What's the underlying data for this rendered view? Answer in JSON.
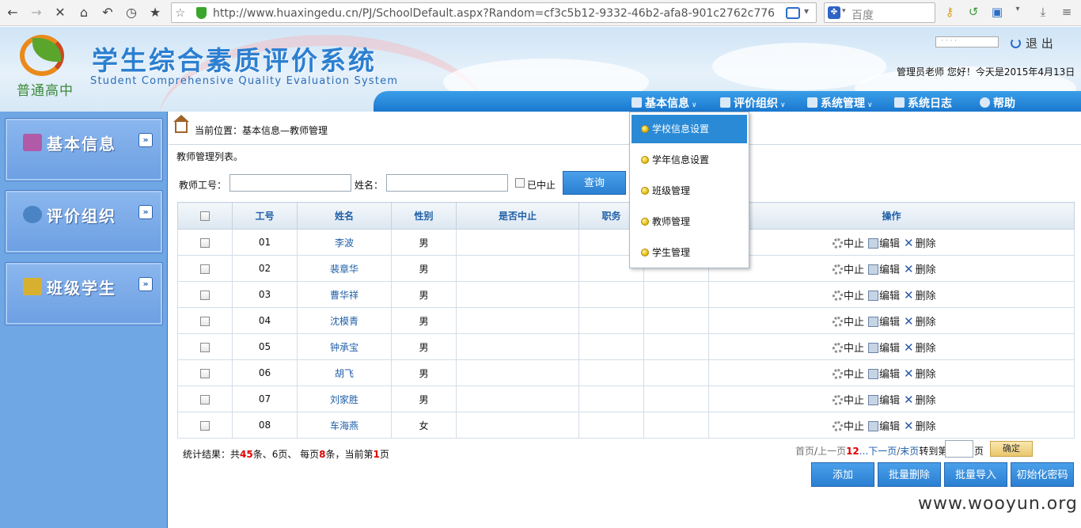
{
  "browser": {
    "url": "http://www.huaxingedu.cn/PJ/SchoolDefault.aspx?Random=cf3c5b12-9332-46b2-afa8-901c2762c776",
    "search_placeholder": "百度"
  },
  "header": {
    "logo_text": "普通高中",
    "title": "学生综合素质评价系统",
    "subtitle": "Student Comprehensive Quality Evaluation System",
    "password_placeholder": "· · · ·",
    "logout_label": "退 出",
    "greeting": "管理员老师 您好！今天是2015年4月13日"
  },
  "nav": {
    "items": [
      {
        "label": "基本信息",
        "icon": "info-icon",
        "has_caret": true
      },
      {
        "label": "评价组织",
        "icon": "person-icon",
        "has_caret": true
      },
      {
        "label": "系统管理",
        "icon": "gear-icon",
        "has_caret": true
      },
      {
        "label": "系统日志",
        "icon": "log-icon",
        "has_caret": false
      },
      {
        "label": "帮助",
        "icon": "help-icon",
        "has_caret": false
      }
    ],
    "dropdown": [
      {
        "label": "学校信息设置",
        "active": true
      },
      {
        "label": "学年信息设置",
        "active": false
      },
      {
        "label": "班级管理",
        "active": false
      },
      {
        "label": "教师管理",
        "active": false
      },
      {
        "label": "学生管理",
        "active": false
      }
    ]
  },
  "sidebar": {
    "items": [
      {
        "label": "基本信息",
        "icon": "briefcase-icon",
        "color": "#b05aa8"
      },
      {
        "label": "评价组织",
        "icon": "globe-icon",
        "color": "#4a84c4"
      },
      {
        "label": "班级学生",
        "icon": "users-icon",
        "color": "#d8b030"
      }
    ]
  },
  "main": {
    "breadcrumb": "当前位置：基本信息—教师管理",
    "list_desc": "教师管理列表。",
    "filter": {
      "teacher_id_label": "教师工号：",
      "name_label": "姓名：",
      "suspended_label": "已中止",
      "query_label": "查询"
    },
    "table": {
      "headers": [
        "",
        "工号",
        "姓名",
        "性别",
        "是否中止",
        "职务",
        "",
        "操作"
      ],
      "rows": [
        {
          "id": "01",
          "name": "李波",
          "gender": "男"
        },
        {
          "id": "02",
          "name": "裴章华",
          "gender": "男"
        },
        {
          "id": "03",
          "name": "曹华祥",
          "gender": "男"
        },
        {
          "id": "04",
          "name": "沈模青",
          "gender": "男"
        },
        {
          "id": "05",
          "name": "钟承宝",
          "gender": "男"
        },
        {
          "id": "06",
          "name": "胡飞",
          "gender": "男"
        },
        {
          "id": "07",
          "name": "刘家胜",
          "gender": "男"
        },
        {
          "id": "08",
          "name": "车海燕",
          "gender": "女"
        }
      ],
      "ops": {
        "suspend": "中止",
        "edit": "编辑",
        "delete": "删除"
      }
    },
    "stats": {
      "prefix": "统计结果：共",
      "total": "45",
      "mid1": "条、6页、 每页",
      "per_page": "8",
      "mid2": "条，当前第",
      "current": "1",
      "suffix": "页"
    },
    "pager": {
      "first": "首页",
      "prev": "上一页",
      "pages": "12",
      "ellipsis": "...",
      "next": "下一页",
      "last": "末页",
      "jump": "转到第",
      "unit": "页",
      "confirm": "确定"
    },
    "actions": [
      "添加",
      "批量删除",
      "批量导入",
      "初始化密码"
    ]
  },
  "watermark": "www.wooyun.org"
}
